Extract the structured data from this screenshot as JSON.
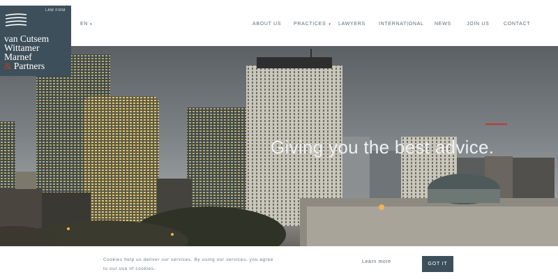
{
  "logo": {
    "firm_tag": "LAW FIRM",
    "line1": "van Cutsem",
    "line2": "Wittamer",
    "line3": "Marnef",
    "amp": "&",
    "line4": "Partners"
  },
  "language": {
    "label": "EN"
  },
  "nav": [
    {
      "label": "ABOUT US"
    },
    {
      "label": "PRACTICES"
    },
    {
      "label": "LAWYERS"
    },
    {
      "label": "INTERNATIONAL"
    },
    {
      "label": "NEWS"
    },
    {
      "label": "JOIN US"
    },
    {
      "label": "CONTACT"
    }
  ],
  "hero": {
    "tagline": "Giving you the best advice."
  },
  "cookie": {
    "message": "Cookies help us deliver our services. By using our services, you agree to our use of cookies.",
    "learn_more": "Learn more",
    "accept": "GOT IT"
  },
  "colors": {
    "brand": "#3d4f5a",
    "accent": "#c0392b"
  }
}
